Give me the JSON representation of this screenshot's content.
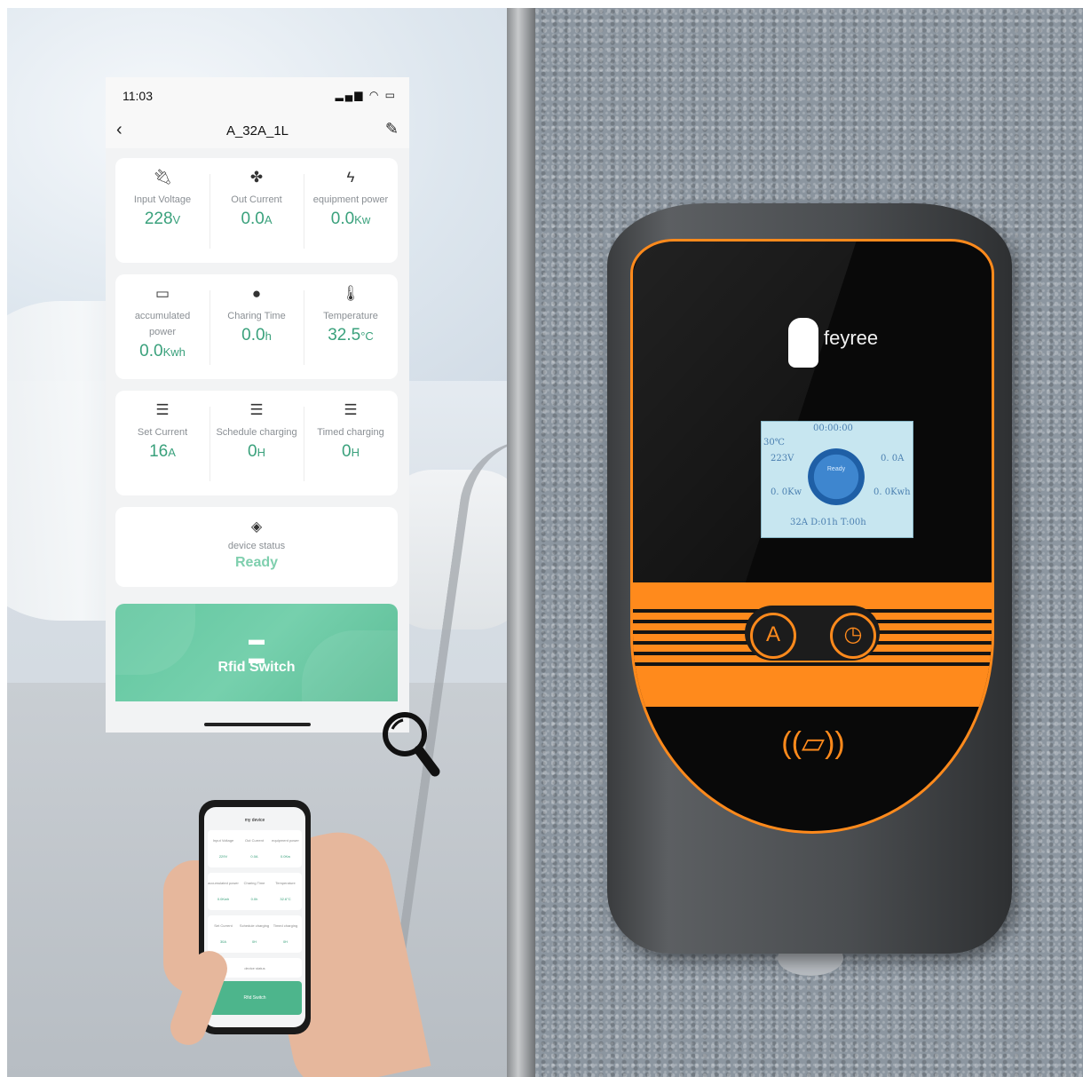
{
  "app": {
    "status_time": "11:03",
    "device_title": "A_32A_1L",
    "cards": [
      {
        "cells": [
          {
            "icon": "plug-icon",
            "label": "Input Voltage",
            "value": "228",
            "unit": "V"
          },
          {
            "icon": "fan-icon",
            "label": "Out Current",
            "value": "0.0",
            "unit": "A"
          },
          {
            "icon": "bolt-icon",
            "label": "equipment power",
            "value": "0.0",
            "unit": "Kw"
          }
        ]
      },
      {
        "cells": [
          {
            "icon": "battery-icon",
            "label": "accumulated power",
            "value": "0.0",
            "unit": "Kwh"
          },
          {
            "icon": "clock-icon",
            "label": "Charing Time",
            "value": "0.0",
            "unit": "h"
          },
          {
            "icon": "thermometer-icon",
            "label": "Temperature",
            "value": "32.5",
            "unit": "°C"
          }
        ]
      },
      {
        "cells": [
          {
            "icon": "menu-icon",
            "label": "Set Current",
            "value": "16",
            "unit": "A"
          },
          {
            "icon": "menu-icon",
            "label": "Schedule charging",
            "value": "0",
            "unit": "H"
          },
          {
            "icon": "menu-icon",
            "label": "Timed charging",
            "value": "0",
            "unit": "H"
          }
        ]
      }
    ],
    "device_status_label": "device status",
    "device_status_value": "Ready",
    "rfid_label": "Rfid Switch",
    "accent": "#3aa17c",
    "rfid_color": "#63c7a0"
  },
  "mini_app": {
    "title": "my device",
    "labels": [
      "Input Voltage",
      "Out Current",
      "equipment power",
      "accumulated power",
      "Charing Time",
      "Temperature",
      "Set Current",
      "Schedule charging",
      "Timed charging",
      "device status"
    ],
    "values": [
      "229V",
      "0.0A",
      "0.0Kw",
      "0.0Kwh",
      "0.0h",
      "32.6°C",
      "30A",
      "0H",
      "0H",
      "Ready"
    ],
    "rfid_label": "Rfid Switch"
  },
  "charger": {
    "brand": "feyree",
    "lcd": {
      "clock": "00:00:00",
      "temp": "30℃",
      "voltage": "223V",
      "current": "0. 0A",
      "power": "0. 0Kw",
      "energy": "0. 0Kwh",
      "ring_text": "Ready",
      "footer": "32A  D:01h  T:00h"
    },
    "button_a": "A",
    "accent": "#ff8a1c"
  }
}
